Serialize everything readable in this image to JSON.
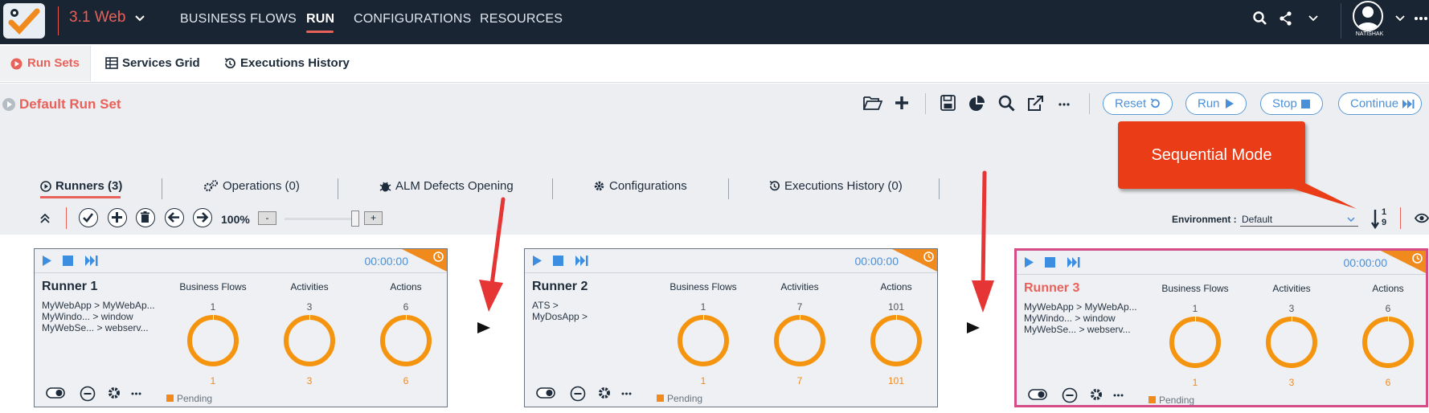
{
  "app": {
    "version_label": "3.1 Web",
    "nav": [
      "BUSINESS FLOWS",
      "RUN",
      "CONFIGURATIONS",
      "RESOURCES"
    ],
    "active_nav": "RUN",
    "username": "NATISHAK"
  },
  "subtabs": [
    "Run Sets",
    "Services Grid",
    "Executions History"
  ],
  "runset": {
    "title": "Default Run Set",
    "buttons": {
      "reset": "Reset",
      "run": "Run",
      "stop": "Stop",
      "continue": "Continue"
    }
  },
  "callout": "Sequential Mode",
  "sections": {
    "runners": "Runners (3)",
    "operations": "Operations (0)",
    "alm": "ALM Defects Opening",
    "configurations": "Configurations",
    "history": "Executions History (0)"
  },
  "toolbar": {
    "zoom": "100%",
    "zoom_minus": "-",
    "zoom_plus": "+",
    "env_label": "Environment :",
    "env_value": "Default",
    "sort_top": "1",
    "sort_bottom": "9"
  },
  "columns": {
    "bf": "Business Flows",
    "act": "Activities",
    "actions": "Actions"
  },
  "runners": [
    {
      "name": "Runner 1",
      "timer": "00:00:00",
      "lines": [
        "MyWebApp > MyWebAp...",
        "MyWindo... > window",
        "MyWebSe... > webserv..."
      ],
      "bf_top": "1",
      "bf_bot": "1",
      "act_top": "3",
      "act_bot": "3",
      "actions_top": "6",
      "actions_bot": "6",
      "status": "Pending"
    },
    {
      "name": "Runner 2",
      "timer": "00:00:00",
      "lines": [
        "ATS >",
        "MyDosApp >",
        ""
      ],
      "bf_top": "1",
      "bf_bot": "1",
      "act_top": "7",
      "act_bot": "7",
      "actions_top": "101",
      "actions_bot": "101",
      "status": "Pending"
    },
    {
      "name": "Runner 3",
      "timer": "00:00:00",
      "lines": [
        "MyWebApp > MyWebAp...",
        "MyWindo... > window",
        "MyWebSe... > webserv..."
      ],
      "bf_top": "1",
      "bf_bot": "1",
      "act_top": "3",
      "act_bot": "3",
      "actions_top": "6",
      "actions_bot": "6",
      "status": "Pending"
    }
  ],
  "colors": {
    "accent": "#e8615a",
    "topbar": "#1a2533",
    "ring": "#f5950f",
    "callout": "#ea3c16",
    "blue": "#4a90d9",
    "selected": "#d44d86"
  }
}
